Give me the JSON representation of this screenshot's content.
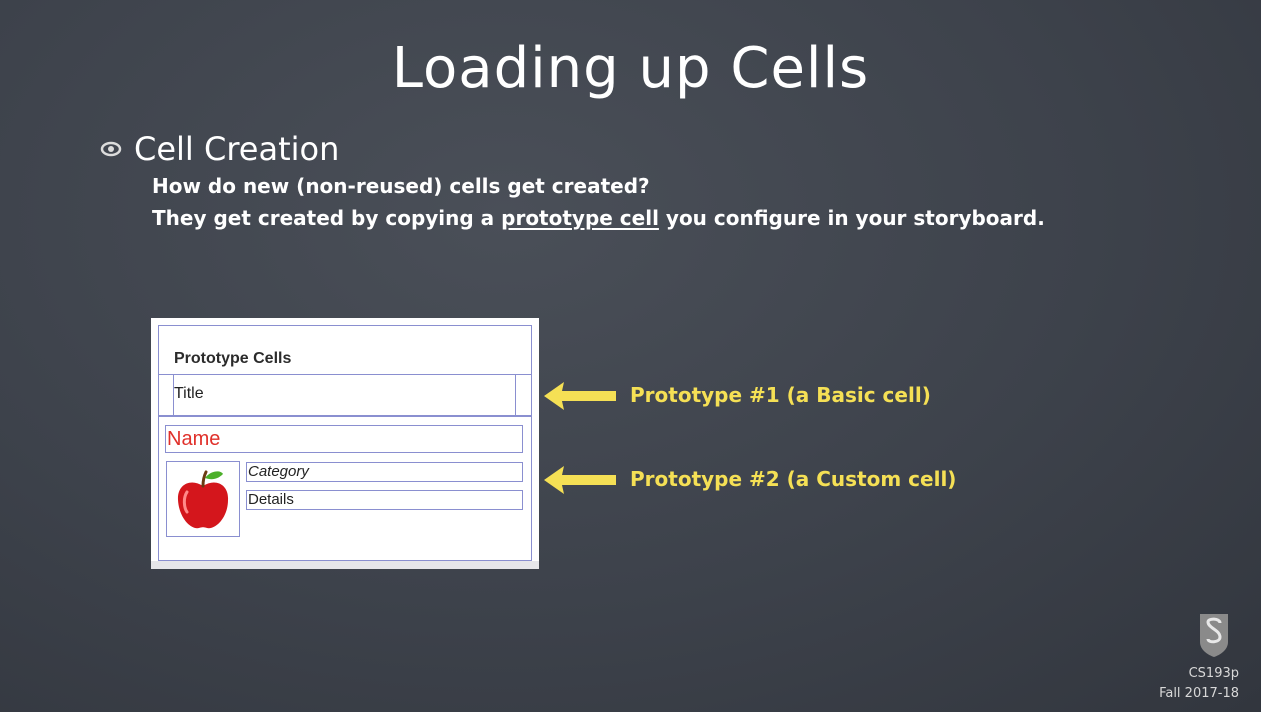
{
  "slide": {
    "title": "Loading up Cells",
    "bullet": "Cell Creation",
    "line1": "How do new (non-reused) cells get created?",
    "line2_before": "They get created by copying a ",
    "line2_link": "prototype cell",
    "line2_after": " you configure in your storyboard."
  },
  "prototype_panel": {
    "section_header": "Prototype Cells",
    "basic_cell_title": "Title",
    "custom_name": "Name",
    "custom_category": "Category",
    "custom_details": "Details",
    "image_icon": "apple-icon"
  },
  "annotations": {
    "proto1": "Prototype #1 (a Basic cell)",
    "proto2": "Prototype #2 (a Custom cell)",
    "arrow_color": "#f5e055"
  },
  "footer": {
    "course": "CS193p",
    "term": "Fall 2017-18"
  },
  "colors": {
    "background": "#3d424b",
    "accent": "#f5e055",
    "name_red": "#e0302a",
    "frame_blue": "#8a8fd0"
  }
}
